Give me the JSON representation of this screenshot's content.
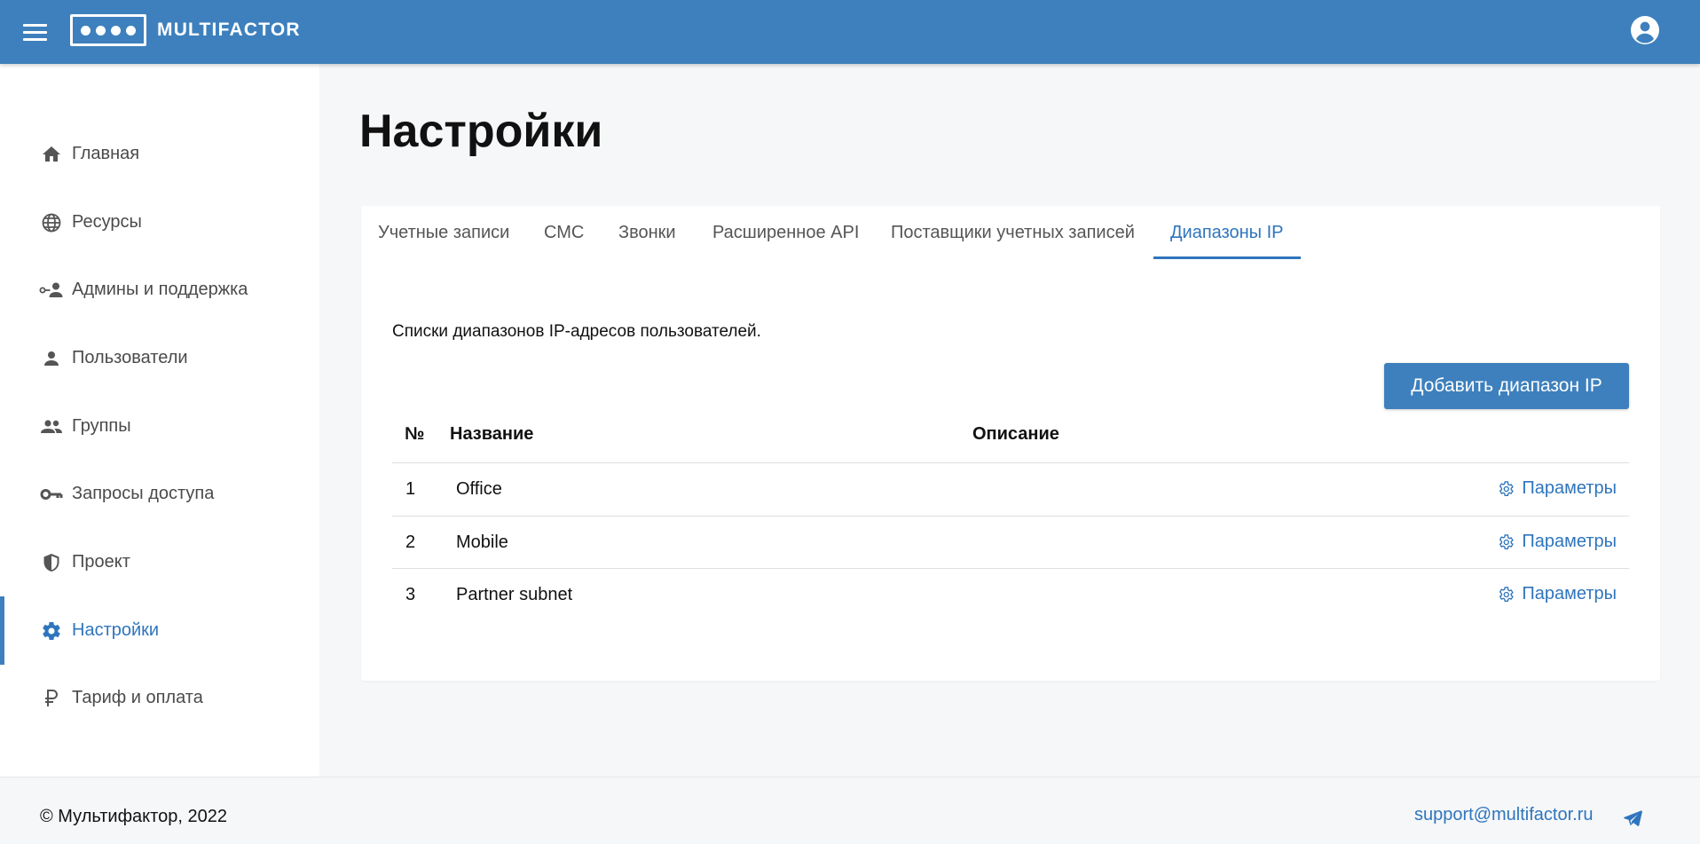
{
  "header": {
    "logo_text": "MULTIFACTOR",
    "menu_icon": "hamburger-icon",
    "account_icon": "account-circle-icon",
    "color": "#3e80bd"
  },
  "sidebar": {
    "items": [
      {
        "label": "Главная",
        "icon": "home-icon",
        "active": false
      },
      {
        "label": "Ресурсы",
        "icon": "globe-icon",
        "active": false
      },
      {
        "label": "Админы и поддержка",
        "icon": "admin-key-icon",
        "active": false
      },
      {
        "label": "Пользователи",
        "icon": "user-icon",
        "active": false
      },
      {
        "label": "Группы",
        "icon": "group-icon",
        "active": false
      },
      {
        "label": "Запросы доступа",
        "icon": "key-icon",
        "active": false
      },
      {
        "label": "Проект",
        "icon": "shield-icon",
        "active": false
      },
      {
        "label": "Настройки",
        "icon": "gear-icon",
        "active": true
      },
      {
        "label": "Тариф и оплата",
        "icon": "ruble-icon",
        "active": false
      }
    ]
  },
  "main": {
    "title": "Настройки",
    "tabs": [
      {
        "label": "Учетные записи",
        "active": false
      },
      {
        "label": "СМС",
        "active": false
      },
      {
        "label": "Звонки",
        "active": false
      },
      {
        "label": "Расширенное API",
        "active": false
      },
      {
        "label": "Поставщики учетных записей",
        "active": false
      },
      {
        "label": "Диапазоны IP",
        "active": true
      }
    ],
    "intro": "Списки диапазонов IP-адресов пользователей.",
    "add_button": "Добавить диапазон IP",
    "table": {
      "headers": {
        "num": "№",
        "name": "Название",
        "description": "Описание"
      },
      "rows": [
        {
          "num": "1",
          "name": "Office",
          "description": "",
          "action": "Параметры"
        },
        {
          "num": "2",
          "name": "Mobile",
          "description": "",
          "action": "Параметры"
        },
        {
          "num": "3",
          "name": "Partner subnet",
          "description": "",
          "action": "Параметры"
        }
      ]
    }
  },
  "footer": {
    "copyright": "© Мультифактор, 2022",
    "support_email": "support@multifactor.ru",
    "telegram_icon": "telegram-icon"
  }
}
